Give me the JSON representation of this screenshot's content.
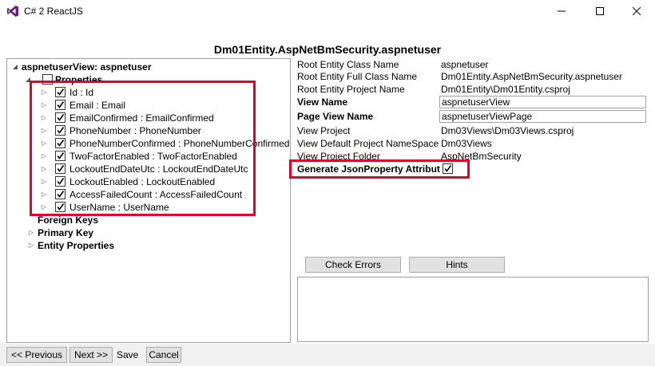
{
  "window": {
    "title": "C# 2 ReactJS",
    "icon": "visual-studio-icon"
  },
  "heading": "Dm01Entity.AspNetBmSecurity.aspnetuser",
  "tree": {
    "root": "aspnetuserView: aspnetuser",
    "properties_label": "Properties",
    "properties": [
      "Id : Id",
      "Email : Email",
      "EmailConfirmed : EmailConfirmed",
      "PhoneNumber : PhoneNumber",
      "PhoneNumberConfirmed : PhoneNumberConfirmed",
      "TwoFactorEnabled : TwoFactorEnabled",
      "LockoutEndDateUtc : LockoutEndDateUtc",
      "LockoutEnabled : LockoutEnabled",
      "AccessFailedCount : AccessFailedCount",
      "UserName : UserName"
    ],
    "foreign_keys": "Foreign Keys",
    "primary_key": "Primary Key",
    "entity_properties": "Entity Properties"
  },
  "props": {
    "root_class_name_label": "Root Entity Class Name",
    "root_class_name": "aspnetuser",
    "root_full_class_name_label": "Root Entity Full Class Name",
    "root_full_class_name": "Dm01Entity.AspNetBmSecurity.aspnetuser",
    "root_project_name_label": "Root Entity Project Name",
    "root_project_name": "Dm01Entity\\Dm01Entity.csproj",
    "view_name_label": "View Name",
    "view_name": "aspnetuserView",
    "page_view_name_label": "Page View Name",
    "page_view_name": "aspnetuserViewPage",
    "view_project_label": "View Project",
    "view_project": "Dm03Views\\Dm03Views.csproj",
    "view_default_ns_label": "View Default Project NameSpace",
    "view_default_ns": "Dm03Views",
    "view_project_folder_label": "View Project Folder",
    "view_project_folder": "AspNetBmSecurity",
    "generate_json_label": "Generate JsonProperty Attribute"
  },
  "buttons": {
    "check_errors": "Check Errors",
    "hints": "Hints",
    "previous": "<< Previous",
    "next": "Next >>",
    "save": "Save",
    "cancel": "Cancel"
  },
  "colors": {
    "highlight": "#e4002b"
  }
}
